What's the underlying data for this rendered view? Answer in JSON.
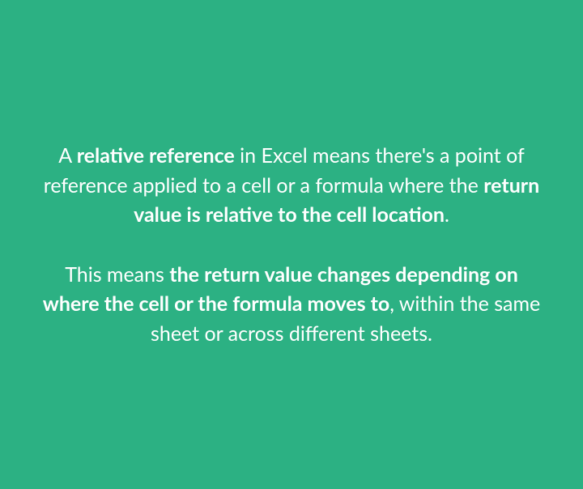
{
  "paragraph1": {
    "part1": "A ",
    "bold1": "relative reference",
    "part2": " in Excel means there's a point of reference applied to a cell or a formula where the ",
    "bold2": "return value is relative to the cell location",
    "part3": "."
  },
  "paragraph2": {
    "part1": "This means ",
    "bold1": "the return value changes depending on where the cell or the formula moves to",
    "part2": ", within the same sheet or across different sheets."
  }
}
